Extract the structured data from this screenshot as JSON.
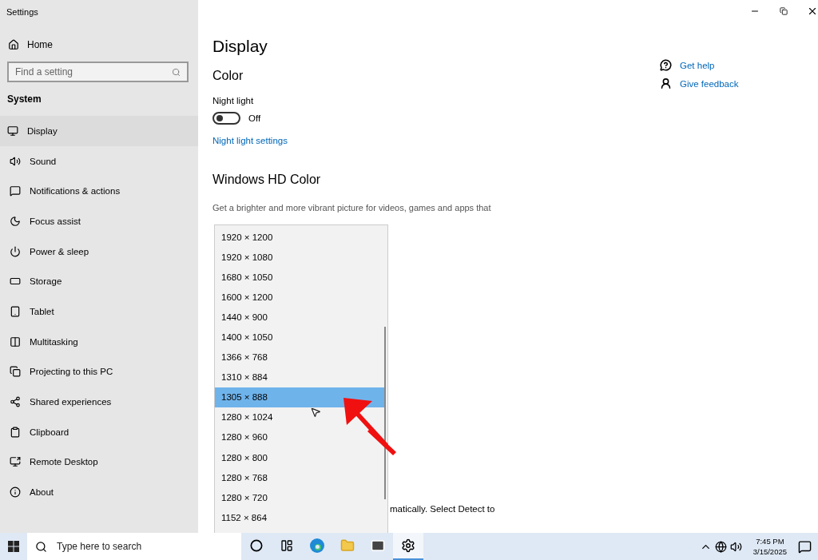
{
  "window": {
    "title": "Settings"
  },
  "sidebar": {
    "home": "Home",
    "search": {
      "placeholder": "Find a setting"
    },
    "section": "System",
    "items": [
      {
        "label": "Display",
        "selected": true
      },
      {
        "label": "Sound",
        "selected": false
      },
      {
        "label": "Notifications & actions",
        "selected": false
      },
      {
        "label": "Focus assist",
        "selected": false
      },
      {
        "label": "Power & sleep",
        "selected": false
      },
      {
        "label": "Storage",
        "selected": false
      },
      {
        "label": "Tablet",
        "selected": false
      },
      {
        "label": "Multitasking",
        "selected": false
      },
      {
        "label": "Projecting to this PC",
        "selected": false
      },
      {
        "label": "Shared experiences",
        "selected": false
      },
      {
        "label": "Clipboard",
        "selected": false
      },
      {
        "label": "Remote Desktop",
        "selected": false
      },
      {
        "label": "About",
        "selected": false
      }
    ]
  },
  "main": {
    "title": "Display",
    "color_heading": "Color",
    "night_light": {
      "label": "Night light",
      "on": false,
      "state_text": "Off"
    },
    "night_light_link": "Night light settings",
    "hd_heading": "Windows HD Color",
    "hd_description": "Get a brighter and more vibrant picture for videos, games and apps that",
    "partial_text": "matically. Select Detect to"
  },
  "help_links": [
    "Get help",
    "Give feedback"
  ],
  "resolution_dropdown": {
    "options": [
      {
        "label": "1920 × 1200",
        "selected": false
      },
      {
        "label": "1920 × 1080",
        "selected": false
      },
      {
        "label": "1680 × 1050",
        "selected": false
      },
      {
        "label": "1600 × 1200",
        "selected": false
      },
      {
        "label": "1440 × 900",
        "selected": false
      },
      {
        "label": "1400 × 1050",
        "selected": false
      },
      {
        "label": "1366 × 768",
        "selected": false
      },
      {
        "label": "1310 × 884",
        "selected": false
      },
      {
        "label": "1305 × 888",
        "selected": true
      },
      {
        "label": "1280 × 1024",
        "selected": false
      },
      {
        "label": "1280 × 960",
        "selected": false
      },
      {
        "label": "1280 × 800",
        "selected": false
      },
      {
        "label": "1280 × 768",
        "selected": false
      },
      {
        "label": "1280 × 720",
        "selected": false
      },
      {
        "label": "1152 × 864",
        "selected": false
      }
    ]
  },
  "taskbar": {
    "search": {
      "placeholder": "Type here to search"
    },
    "apps": [
      {
        "selected": false
      },
      {
        "selected": false
      },
      {
        "selected": false
      },
      {
        "selected": false
      },
      {
        "selected": false
      },
      {
        "selected": true
      }
    ],
    "time": "7:45 PM",
    "date": "3/15/2025"
  }
}
